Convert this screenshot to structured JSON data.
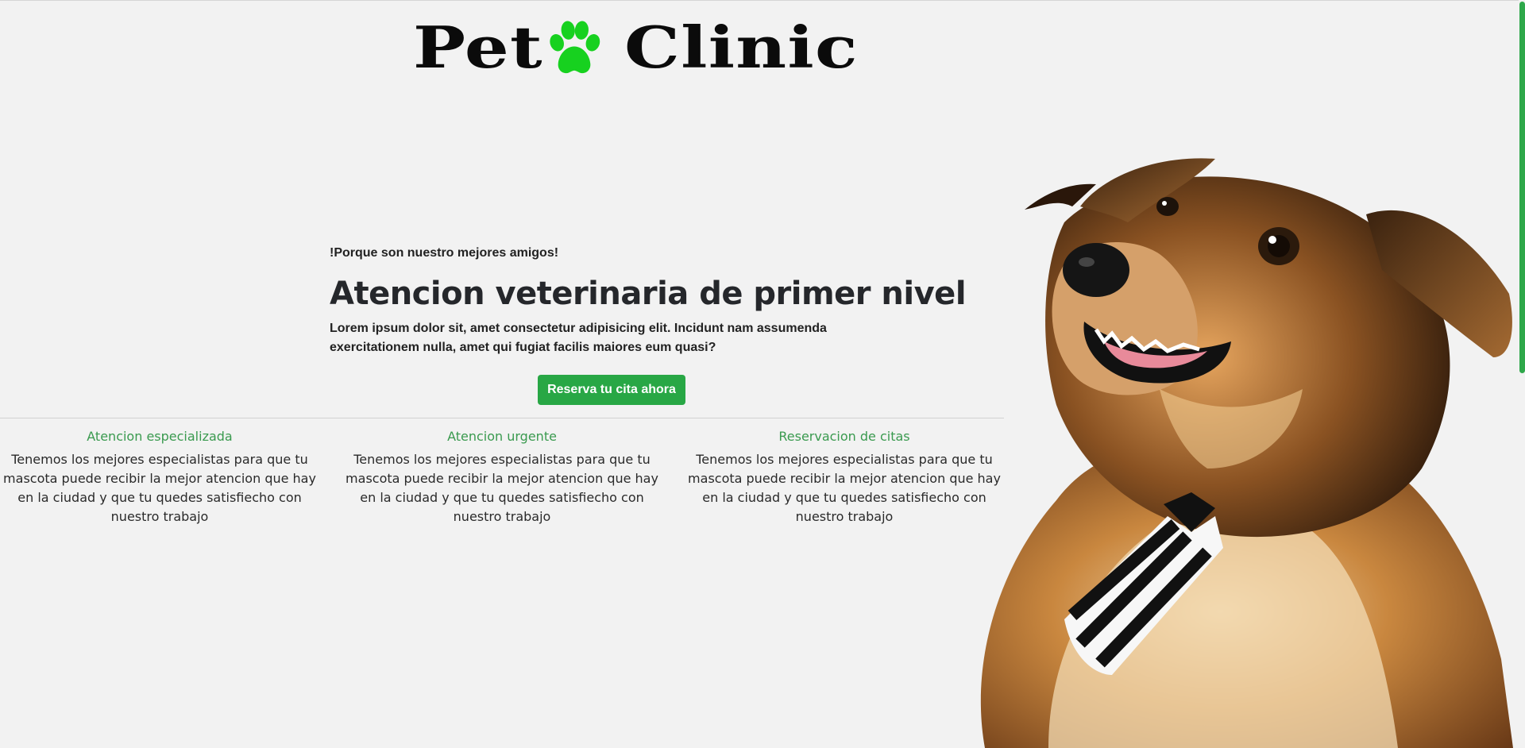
{
  "brand": {
    "word_left": "Pet",
    "word_right": "Clinic",
    "paw_color": "#17d11f"
  },
  "hero": {
    "kicker": "!Porque son nuestro mejores amigos!",
    "title": "Atencion veterinaria de primer nivel",
    "description": "Lorem ipsum dolor sit, amet consectetur adipisicing elit. Incidunt nam assumenda exercitationem nulla, amet qui fugiat facilis maiores eum quasi?",
    "cta_label": "Reserva tu cita ahora"
  },
  "features": [
    {
      "title": "Atencion especializada",
      "text": "Tenemos los mejores especialistas para que tu mascota puede recibir la mejor atencion que hay en la ciudad y que tu quedes satisfiecho con nuestro trabajo"
    },
    {
      "title": "Atencion urgente",
      "text": "Tenemos los mejores especialistas para que tu mascota puede recibir la mejor atencion que hay en la ciudad y que tu quedes satisfiecho con nuestro trabajo"
    },
    {
      "title": "Reservacion de citas",
      "text": "Tenemos los mejores especialistas para que tu mascota puede recibir la mejor atencion que hay en la ciudad y que tu quedes satisfiecho con nuestro trabajo"
    }
  ],
  "colors": {
    "background": "#f2f2f2",
    "accent": "#28a745",
    "feature_title": "#3a9a4f",
    "scrollbar": "#2ea84a"
  },
  "icons": {
    "paw": "paw-icon",
    "hero_image": "dog-with-tie-image"
  }
}
